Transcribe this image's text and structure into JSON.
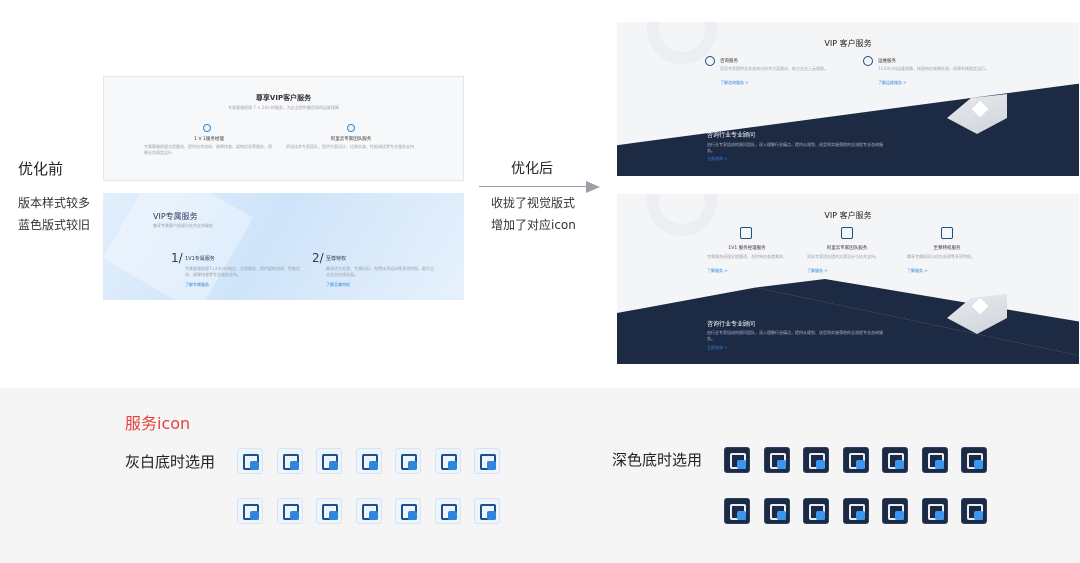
{
  "before": {
    "label": "优化前",
    "desc1": "版本样式较多",
    "desc2": "蓝色版式较旧",
    "card1": {
      "title": "尊享VIP客户服务",
      "sub": "专属客服经理 7 × 24小时服务，为企业提供最优质的运维保障",
      "col1": "1 V 1服务经理",
      "col2": "阿里云专家团队服务",
      "col1_text": "专属客服经理全程跟进，提供技术咨询、故障排查、架构优化等服务，保障业务稳定运行",
      "col2_text": "资深技术专家团队，提供方案设计、迁移实施、性能调优等专业服务支持"
    },
    "card2": {
      "title": "VIP专属服务",
      "sub": "尊享专属客户经理与技术支持服务",
      "item1_num": "1/",
      "item1_title": "1V1专属服务",
      "item1_text": "专属客服经理7×24小时响应，全程跟进，提供架构咨询、性能优化、故障排查等专业服务支持。",
      "item1_link": "了解专属服务",
      "item2_num": "2/",
      "item2_title": "至尊特权",
      "item2_text": "尊享优先处理、专属折扣、免费技术培训等多项特权，助力企业业务快速发展。",
      "item2_link": "了解至尊特权"
    }
  },
  "arrow": {
    "label": "优化后",
    "desc1": "收拢了视觉版式",
    "desc2": "增加了对应icon"
  },
  "after": {
    "card1": {
      "title": "VIP 客户服务",
      "s1": "咨询服务",
      "s2": "运维服务",
      "s1_text": "资深专家提供业务咨询与技术方案建议，助力企业上云规划。",
      "s2_text": "7×24小时运维保障，快速响应故障处理，保障系统稳定运行。",
      "s1_link": "了解咨询服务 >",
      "s2_link": "了解运维服务 >",
      "dark_title": "咨询行业专业顾问",
      "dark_text": "由行业专家组成的顾问团队，深入理解行业痛点，提供从规划、选型到实施落地的全流程专业咨询服务。",
      "dark_link": "立即咨询 >"
    },
    "card2": {
      "title": "VIP 客户服务",
      "s1": "1V1 服务经理服务",
      "s2": "阿里云专家团队服务",
      "s3": "至尊特权服务",
      "t1": "专属服务经理全程跟进，及时响应各类需求。",
      "t2": "资深专家团队提供方案设计与技术支持。",
      "t3": "尊享专属折扣与优先处理等多项特权。",
      "l1": "了解服务 >",
      "l2": "了解服务 >",
      "l3": "了解服务 >",
      "dark_title": "咨询行业专业顾问",
      "dark_text": "由行业专家组成的顾问团队，深入理解行业痛点，提供从规划、选型到实施落地的全流程专业咨询服务。",
      "dark_link": "立即咨询 >"
    }
  },
  "icons": {
    "heading": "服务icon",
    "light_label": "灰白底时选用",
    "dark_label": "深色底时选用",
    "light_row1": [
      "monitor-shield-icon",
      "building-document-icon",
      "folder-arrow-icon",
      "code-settings-icon",
      "users-group-icon",
      "certificate-icon",
      "crown-icon"
    ],
    "light_row2": [
      "chat-users-icon",
      "person-wrench-icon",
      "book-icon",
      "cloud-monitor-icon",
      "diamond-icon",
      "headset-icon",
      "network-plug-icon"
    ],
    "dark_row1": [
      "document-plus-icon",
      "building-document-icon",
      "folder-arrow-icon",
      "code-settings-icon",
      "person-badge-icon",
      "certificate-icon",
      "crown-icon"
    ],
    "dark_row2": [
      "person-card-icon",
      "person-wrench-icon",
      "book-icon",
      "cloud-monitor-icon",
      "diamond-icon",
      "headset-icon",
      "network-plug-icon"
    ]
  },
  "colors": {
    "accent": "#2e86de",
    "dark": "#1d2a44",
    "red": "#e8413c"
  }
}
